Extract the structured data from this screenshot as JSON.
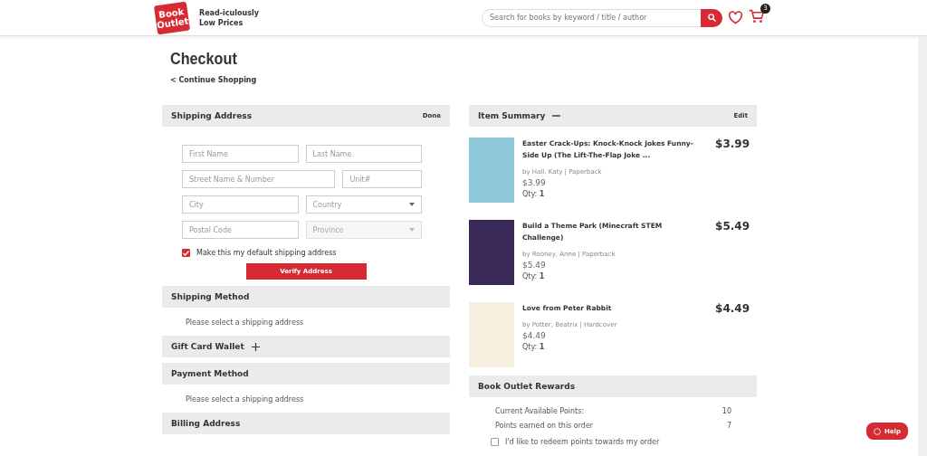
{
  "header": {
    "logo": {
      "line_1": "Book",
      "line_2": "Outlet"
    },
    "tagline": "Read-iculously Low Prices",
    "search": {
      "placeholder": "Search for books by keyword / title / author"
    },
    "cart_count": "3"
  },
  "page": {
    "title": "Checkout",
    "back_link": "< Continue Shopping"
  },
  "shipping_address": {
    "title": "Shipping Address",
    "action": "Done",
    "fields": [
      {
        "placeholder": "First Name",
        "kind": "text"
      },
      {
        "placeholder": "Last Name",
        "kind": "text"
      },
      {
        "placeholder": "Street Name & Number",
        "kind": "text"
      },
      {
        "placeholder": "Unit#",
        "kind": "text"
      },
      {
        "placeholder": "City",
        "kind": "text"
      },
      {
        "placeholder": "Country",
        "kind": "select",
        "disabled": false
      },
      {
        "placeholder": "Postal Code",
        "kind": "text"
      },
      {
        "placeholder": "Province",
        "kind": "select",
        "disabled": true
      }
    ],
    "default_checkbox": {
      "label": "Make this my default shipping address",
      "checked": true
    },
    "verify_button": "Verify Address"
  },
  "sections": [
    {
      "title": "Shipping Method",
      "message": "Please select a shipping address"
    },
    {
      "title": "Gift Card Wallet",
      "expandable": true
    },
    {
      "title": "Payment Method",
      "message": "Please select a shipping address"
    },
    {
      "title": "Billing Address"
    }
  ],
  "item_summary": {
    "title": "Item Summary",
    "action": "Edit",
    "items": [
      {
        "title": "Easter Crack-Ups: Knock-Knock Jokes Funny-Side Up (The Lift-The-Flap Joke ...",
        "byline": "by Hall, Katy | Paperback",
        "price": "$3.99",
        "qty_label": "Qty:",
        "qty": "1",
        "total": "$3.99",
        "color": "#8cc8d8"
      },
      {
        "title": "Build a Theme Park (Minecraft STEM Challenge)",
        "byline": "by Rooney, Anne | Paperback",
        "price": "$5.49",
        "qty_label": "Qty:",
        "qty": "1",
        "total": "$5.49",
        "color": "#3a2a5a"
      },
      {
        "title": "Love from Peter Rabbit",
        "byline": "by Potter, Beatrix | Hardcover",
        "price": "$4.49",
        "qty_label": "Qty:",
        "qty": "1",
        "total": "$4.49",
        "color": "#f6efe0"
      }
    ]
  },
  "rewards": {
    "title": "Book Outlet Rewards",
    "rows": [
      {
        "label": "Current Available Points:",
        "value": "10"
      },
      {
        "label": "Points earned on this order",
        "value": "7"
      }
    ],
    "redeem": {
      "label": "I'd like to redeem points towards my order",
      "checked": false
    }
  },
  "help_button": "Help"
}
